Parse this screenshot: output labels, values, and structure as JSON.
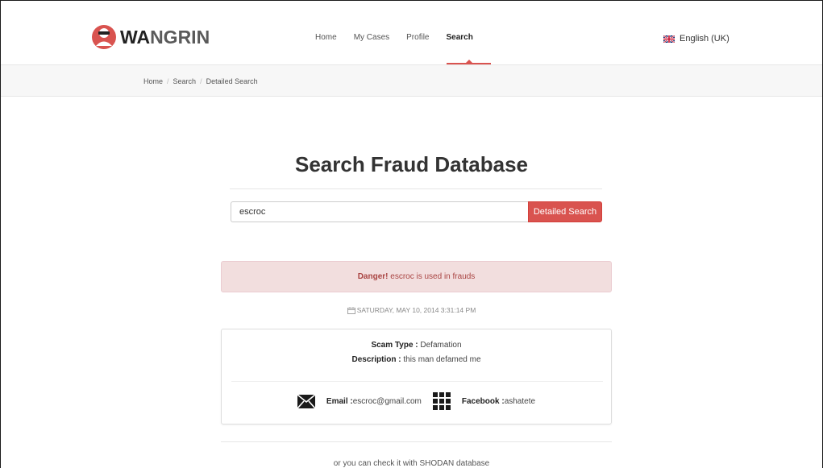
{
  "brand": {
    "name_dark": "WA",
    "name_light": "NGRIN"
  },
  "nav": {
    "items": [
      {
        "label": "Home"
      },
      {
        "label": "My Cases"
      },
      {
        "label": "Profile"
      },
      {
        "label": "Search"
      }
    ],
    "active": "Search"
  },
  "language": {
    "label": "English (UK)"
  },
  "breadcrumb": {
    "items": [
      "Home",
      "Search",
      "Detailed Search"
    ],
    "separator": "/"
  },
  "main": {
    "title": "Search Fraud Database",
    "search": {
      "value": "escroc",
      "button_label": "Detailed Search"
    },
    "alert": {
      "strong": "Danger!",
      "text": " escroc is used in frauds"
    },
    "date": "SATURDAY, MAY 10, 2014 3:31:14 PM",
    "card": {
      "scam_type_label": "Scam Type :",
      "scam_type_value": " Defamation",
      "description_label": "Description :",
      "description_value": " this man defamed me",
      "email_label": "Email :",
      "email_value": " escroc@gmail.com",
      "facebook_label": "Facebook :",
      "facebook_value": " ashatete"
    },
    "footer_text": "or you can check it with SHODAN database"
  },
  "colors": {
    "accent": "#d9534f",
    "alert_bg": "#f2dede",
    "alert_text": "#a94442"
  }
}
